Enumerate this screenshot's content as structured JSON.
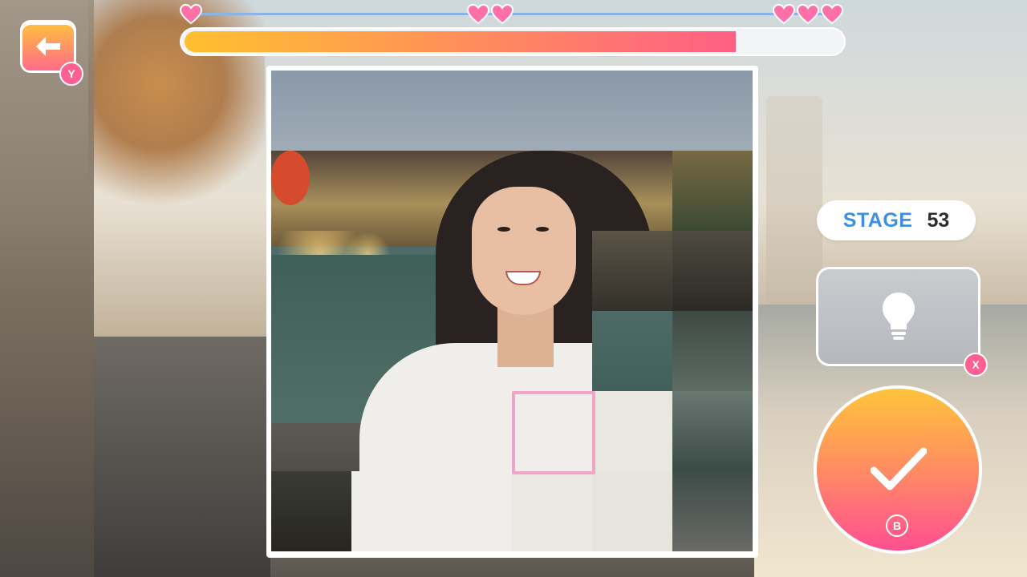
{
  "hud": {
    "back_badge": "Y",
    "hint_badge": "X",
    "confirm_badge": "B",
    "stage_label": "STAGE",
    "stage_number": "53"
  },
  "progress": {
    "fraction": 0.84,
    "milestones": [
      {
        "hearts": 1,
        "position": 0.0
      },
      {
        "hearts": 2,
        "position": 0.465
      },
      {
        "hearts": 3,
        "position": 0.96
      }
    ]
  },
  "puzzle": {
    "grid": "6x6",
    "selected_tile": {
      "row": 5,
      "col": 4
    }
  },
  "icons": {
    "back": "arrow-left-icon",
    "heart": "heart-icon",
    "hint": "lightbulb-icon",
    "confirm": "check-icon"
  },
  "colors": {
    "accent_orange": "#ffc12f",
    "accent_pink": "#ff5f85",
    "stage_blue": "#3d8fe0",
    "selection_pink": "#f0a5c8",
    "hint_gray": "#c1c4c8"
  }
}
